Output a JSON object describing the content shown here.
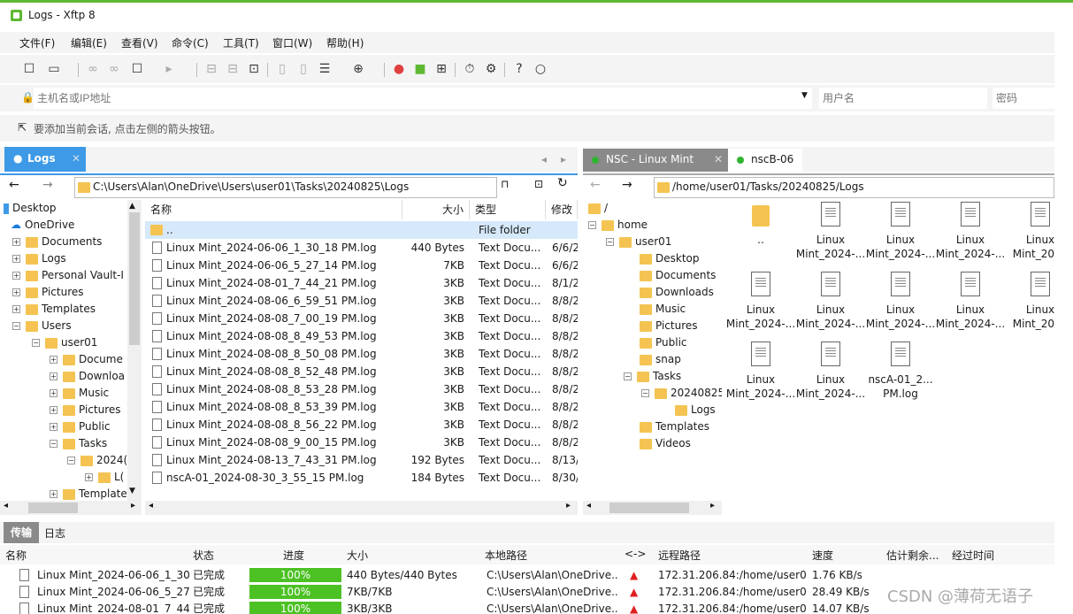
{
  "window": {
    "title": "Logs - Xftp 8"
  },
  "menu": [
    "文件(F)",
    "编辑(E)",
    "查看(V)",
    "命令(C)",
    "工具(T)",
    "窗口(W)",
    "帮助(H)"
  ],
  "address": {
    "host_placeholder": "主机名或IP地址",
    "user_placeholder": "用户名",
    "password_placeholder": "密码"
  },
  "hint": "要添加当前会话, 点击左侧的箭头按钮。",
  "local": {
    "tab_label": "Logs",
    "path": "C:\\Users\\Alan\\OneDrive\\Users\\user01\\Tasks\\20240825\\Logs",
    "tree": [
      "Desktop",
      "OneDrive",
      "Documents",
      "Logs",
      "Personal Vault-I",
      "Pictures",
      "Templates",
      "Users",
      "user01",
      "Docume",
      "Downloa",
      "Music",
      "Pictures",
      "Public",
      "Tasks",
      "2024(",
      "L(",
      "Template"
    ],
    "columns": [
      "名称",
      "大小",
      "类型",
      "修改"
    ],
    "rows": [
      {
        "name": "..",
        "size": "",
        "type": "File folder",
        "date": ""
      },
      {
        "name": "Linux Mint_2024-06-06_1_30_18 PM.log",
        "size": "440 Bytes",
        "type": "Text Docu...",
        "date": "6/6/2"
      },
      {
        "name": "Linux Mint_2024-06-06_5_27_14 PM.log",
        "size": "7KB",
        "type": "Text Docu...",
        "date": "6/6/2"
      },
      {
        "name": "Linux Mint_2024-08-01_7_44_21 PM.log",
        "size": "3KB",
        "type": "Text Docu...",
        "date": "8/1/2"
      },
      {
        "name": "Linux Mint_2024-08-06_6_59_51 PM.log",
        "size": "3KB",
        "type": "Text Docu...",
        "date": "8/8/2"
      },
      {
        "name": "Linux Mint_2024-08-08_7_00_19 PM.log",
        "size": "3KB",
        "type": "Text Docu...",
        "date": "8/8/2"
      },
      {
        "name": "Linux Mint_2024-08-08_8_49_53 PM.log",
        "size": "3KB",
        "type": "Text Docu...",
        "date": "8/8/2"
      },
      {
        "name": "Linux Mint_2024-08-08_8_50_08 PM.log",
        "size": "3KB",
        "type": "Text Docu...",
        "date": "8/8/2"
      },
      {
        "name": "Linux Mint_2024-08-08_8_52_48 PM.log",
        "size": "3KB",
        "type": "Text Docu...",
        "date": "8/8/2"
      },
      {
        "name": "Linux Mint_2024-08-08_8_53_28 PM.log",
        "size": "3KB",
        "type": "Text Docu...",
        "date": "8/8/2"
      },
      {
        "name": "Linux Mint_2024-08-08_8_53_39 PM.log",
        "size": "3KB",
        "type": "Text Docu...",
        "date": "8/8/2"
      },
      {
        "name": "Linux Mint_2024-08-08_8_56_22 PM.log",
        "size": "3KB",
        "type": "Text Docu...",
        "date": "8/8/2"
      },
      {
        "name": "Linux Mint_2024-08-08_9_00_15 PM.log",
        "size": "3KB",
        "type": "Text Docu...",
        "date": "8/8/2"
      },
      {
        "name": "Linux Mint_2024-08-13_7_43_31 PM.log",
        "size": "192 Bytes",
        "type": "Text Docu...",
        "date": "8/13/"
      },
      {
        "name": "nscA-01_2024-08-30_3_55_15 PM.log",
        "size": "184 Bytes",
        "type": "Text Docu...",
        "date": "8/30/"
      }
    ]
  },
  "remote": {
    "tabs": [
      "NSC - Linux Mint",
      "nscB-06"
    ],
    "path": "/home/user01/Tasks/20240825/Logs",
    "tree": [
      "/",
      "home",
      "user01",
      "Desktop",
      "Documents",
      "Downloads",
      "Music",
      "Pictures",
      "Public",
      "snap",
      "Tasks",
      "20240825",
      "Logs",
      "Templates",
      "Videos"
    ],
    "icons": [
      {
        "line1": "..",
        "line2": ""
      },
      {
        "line1": "Linux",
        "line2": "Mint_2024-..."
      },
      {
        "line1": "Linux",
        "line2": "Mint_2024-..."
      },
      {
        "line1": "Linux",
        "line2": "Mint_2024-..."
      },
      {
        "line1": "Linux",
        "line2": "Mint_2024"
      },
      {
        "line1": "Linux",
        "line2": "Mint_2024-..."
      },
      {
        "line1": "Linux",
        "line2": "Mint_2024-..."
      },
      {
        "line1": "Linux",
        "line2": "Mint_2024-..."
      },
      {
        "line1": "Linux",
        "line2": "Mint_2024-..."
      },
      {
        "line1": "Linux",
        "line2": "Mint_2024"
      },
      {
        "line1": "Linux",
        "line2": "Mint_2024-..."
      },
      {
        "line1": "Linux",
        "line2": "Mint_2024-..."
      },
      {
        "line1": "nscA-01_2...",
        "line2": "PM.log"
      }
    ]
  },
  "transfer": {
    "tabs": [
      "传输",
      "日志"
    ],
    "columns": [
      "名称",
      "状态",
      "进度",
      "大小",
      "本地路径",
      "<->",
      "远程路径",
      "速度",
      "估计剩余...",
      "经过时间"
    ],
    "rows": [
      {
        "name": "Linux Mint_2024-06-06_1_30...",
        "status": "已完成",
        "progress": "100%",
        "size": "440 Bytes/440 Bytes",
        "local": "C:\\Users\\Alan\\OneDrive...",
        "remote": "172.31.206.84:/home/user01...",
        "speed": "1.76 KB/s"
      },
      {
        "name": "Linux Mint_2024-06-06_5_27...",
        "status": "已完成",
        "progress": "100%",
        "size": "7KB/7KB",
        "local": "C:\\Users\\Alan\\OneDrive...",
        "remote": "172.31.206.84:/home/user01...",
        "speed": "28.49 KB/s"
      },
      {
        "name": "Linux Mint_2024-08-01_7_44...",
        "status": "已完成",
        "progress": "100%",
        "size": "3KB/3KB",
        "local": "C:\\Users\\Alan\\OneDrive...",
        "remote": "172.31.206.84:/home/user01...",
        "speed": "14.07 KB/s"
      }
    ]
  },
  "watermark": "CSDN @薄荷无语子",
  "colors": {
    "accent": "#3e9ae6",
    "brand": "#5fb833",
    "progress": "#4cc124",
    "selected": "#d6e9fb"
  }
}
